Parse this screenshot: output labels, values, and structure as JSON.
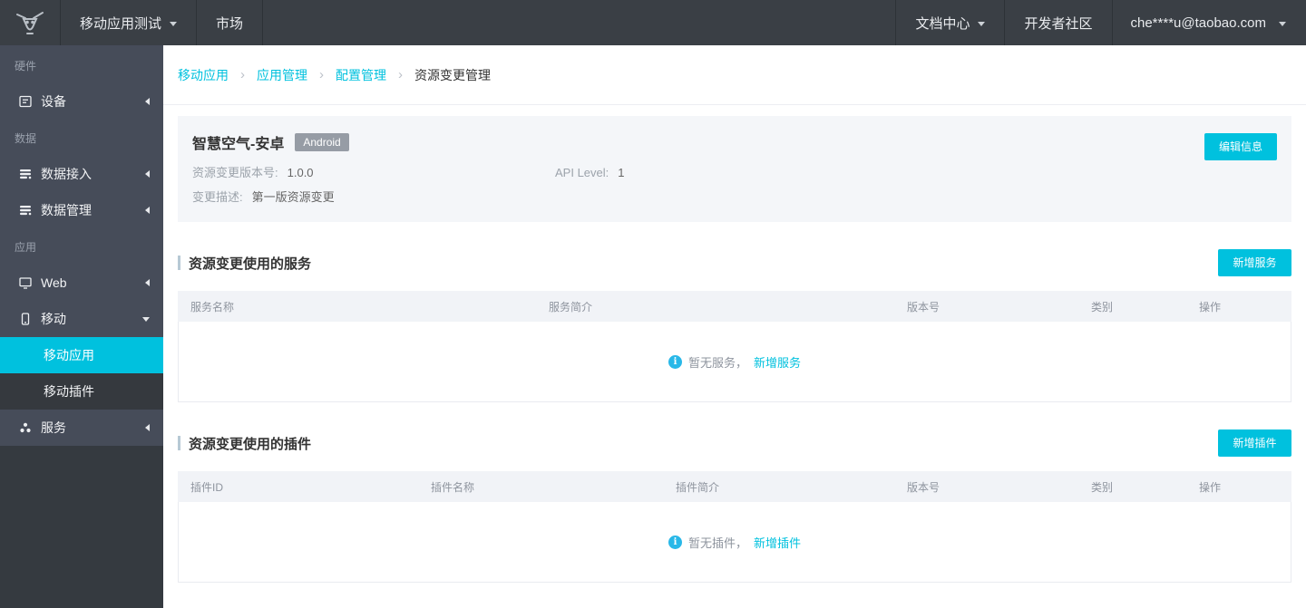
{
  "topbar": {
    "logo_icon": "app-logo",
    "nav_left": [
      {
        "label": "移动应用测试",
        "has_dropdown": true
      },
      {
        "label": "市场",
        "has_dropdown": false
      }
    ],
    "nav_right": [
      {
        "label": "文档中心",
        "has_dropdown": true
      },
      {
        "label": "开发者社区",
        "has_dropdown": false
      },
      {
        "label": "che****u@taobao.com",
        "has_dropdown": true
      }
    ]
  },
  "sidebar": {
    "sections": [
      {
        "category": "硬件",
        "items": [
          {
            "label": "设备",
            "icon": "device-icon",
            "state": "collapsed"
          }
        ]
      },
      {
        "category": "数据",
        "items": [
          {
            "label": "数据接入",
            "icon": "data-access-icon",
            "state": "collapsed"
          },
          {
            "label": "数据管理",
            "icon": "data-manage-icon",
            "state": "collapsed"
          }
        ]
      },
      {
        "category": "应用",
        "items": [
          {
            "label": "Web",
            "icon": "web-icon",
            "state": "collapsed"
          },
          {
            "label": "移动",
            "icon": "mobile-icon",
            "state": "expanded",
            "children": [
              {
                "label": "移动应用",
                "active": true
              },
              {
                "label": "移动插件",
                "active": false
              }
            ]
          },
          {
            "label": "服务",
            "icon": "services-icon",
            "state": "collapsed"
          }
        ]
      }
    ]
  },
  "breadcrumb": {
    "separator": "›",
    "items": [
      {
        "label": "移动应用",
        "link": true
      },
      {
        "label": "应用管理",
        "link": true
      },
      {
        "label": "配置管理",
        "link": true
      },
      {
        "label": "资源变更管理",
        "link": false
      }
    ]
  },
  "app_card": {
    "title": "智慧空气-安卓",
    "platform_badge": "Android",
    "edit_button": "编辑信息",
    "fields": {
      "version_label": "资源变更版本号:",
      "version_value": "1.0.0",
      "api_level_label": "API Level:",
      "api_level_value": "1",
      "desc_label": "变更描述:",
      "desc_value": "第一版资源变更"
    }
  },
  "services_section": {
    "title": "资源变更使用的服务",
    "add_button": "新增服务",
    "table_headers": [
      "服务名称",
      "服务简介",
      "版本号",
      "类别",
      "操作"
    ],
    "rows": [],
    "empty_icon": "info-icon",
    "empty_text": "暂无服务，",
    "empty_link": "新增服务"
  },
  "plugins_section": {
    "title": "资源变更使用的插件",
    "add_button": "新增插件",
    "table_headers": [
      "插件ID",
      "插件名称",
      "插件简介",
      "版本号",
      "类别",
      "操作"
    ],
    "rows": [],
    "empty_icon": "info-icon",
    "empty_text": "暂无插件，",
    "empty_link": "新增插件"
  },
  "colors": {
    "accent_cyan": "#00c1de",
    "topbar_bg": "#3a3f45",
    "sidebar_bg": "#464c59",
    "sidebar_submenu_bg": "#35393e",
    "active_item_bg": "#00c1de",
    "info_icon_blue": "#29b8e8",
    "badge_grey": "#969ca5",
    "card_bg": "#f4f6f9"
  }
}
